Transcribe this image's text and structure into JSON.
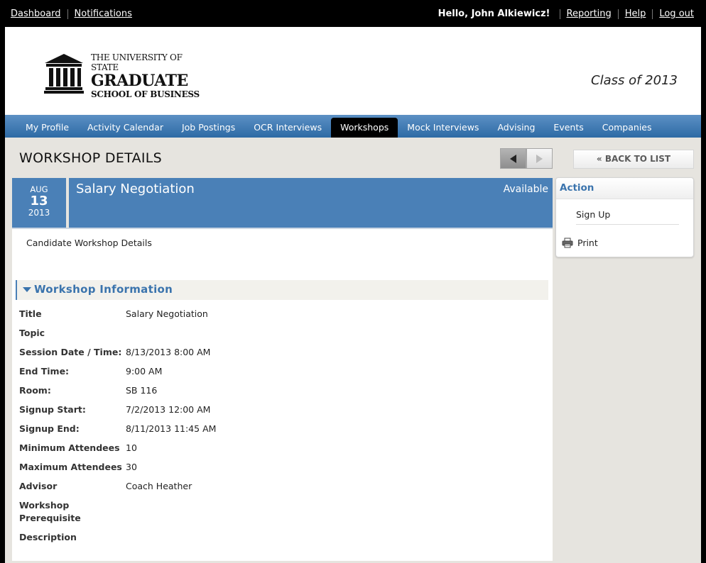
{
  "topbar": {
    "dashboard": "Dashboard",
    "notifications": "Notifications",
    "greeting": "Hello, John Alkiewicz!",
    "reporting": "Reporting",
    "help": "Help",
    "logout": "Log out"
  },
  "header": {
    "logo_line1": "THE UNIVERSITY OF STATE",
    "logo_line2": "GRADUATE",
    "logo_line3": "SCHOOL OF BUSINESS",
    "class_of": "Class of 2013"
  },
  "nav": {
    "items": [
      {
        "label": "My Profile"
      },
      {
        "label": "Activity Calendar"
      },
      {
        "label": "Job Postings"
      },
      {
        "label": "OCR Interviews"
      },
      {
        "label": "Workshops"
      },
      {
        "label": "Mock Interviews"
      },
      {
        "label": "Advising"
      },
      {
        "label": "Events"
      },
      {
        "label": "Companies"
      }
    ],
    "active": "Workshops"
  },
  "page": {
    "title": "WORKSHOP DETAILS",
    "back_label": "« BACK TO LIST"
  },
  "event": {
    "month": "AUG",
    "day": "13",
    "year": "2013",
    "title": "Salary Negotiation",
    "status": "Available",
    "subtitle": "Candidate Workshop Details"
  },
  "section": {
    "title": "Workshop Information"
  },
  "fields": [
    {
      "label": "Title",
      "value": "Salary Negotiation"
    },
    {
      "label": "Topic",
      "value": ""
    },
    {
      "label": "Session Date / Time:",
      "value": "8/13/2013 8:00 AM"
    },
    {
      "label": "End Time:",
      "value": "9:00 AM"
    },
    {
      "label": "Room:",
      "value": "SB 116"
    },
    {
      "label": "Signup Start:",
      "value": "7/2/2013 12:00 AM"
    },
    {
      "label": "Signup End:",
      "value": "8/11/2013 11:45 AM"
    },
    {
      "label": "Minimum Attendees",
      "value": "10"
    },
    {
      "label": "Maximum Attendees",
      "value": "30"
    },
    {
      "label": "Advisor",
      "value": "Coach Heather"
    },
    {
      "label": "Workshop Prerequisite",
      "value": ""
    },
    {
      "label": "Description",
      "value": ""
    }
  ],
  "action": {
    "title": "Action",
    "signup": "Sign Up",
    "print": "Print"
  },
  "colors": {
    "accent": "#4a80b7",
    "nav_active": "#000000",
    "heading": "#3b74ad"
  },
  "icons": {
    "prev": "arrow-left-icon",
    "next": "arrow-right-icon",
    "section": "caret-down-icon",
    "print": "printer-icon",
    "logo": "building-columns-icon"
  }
}
